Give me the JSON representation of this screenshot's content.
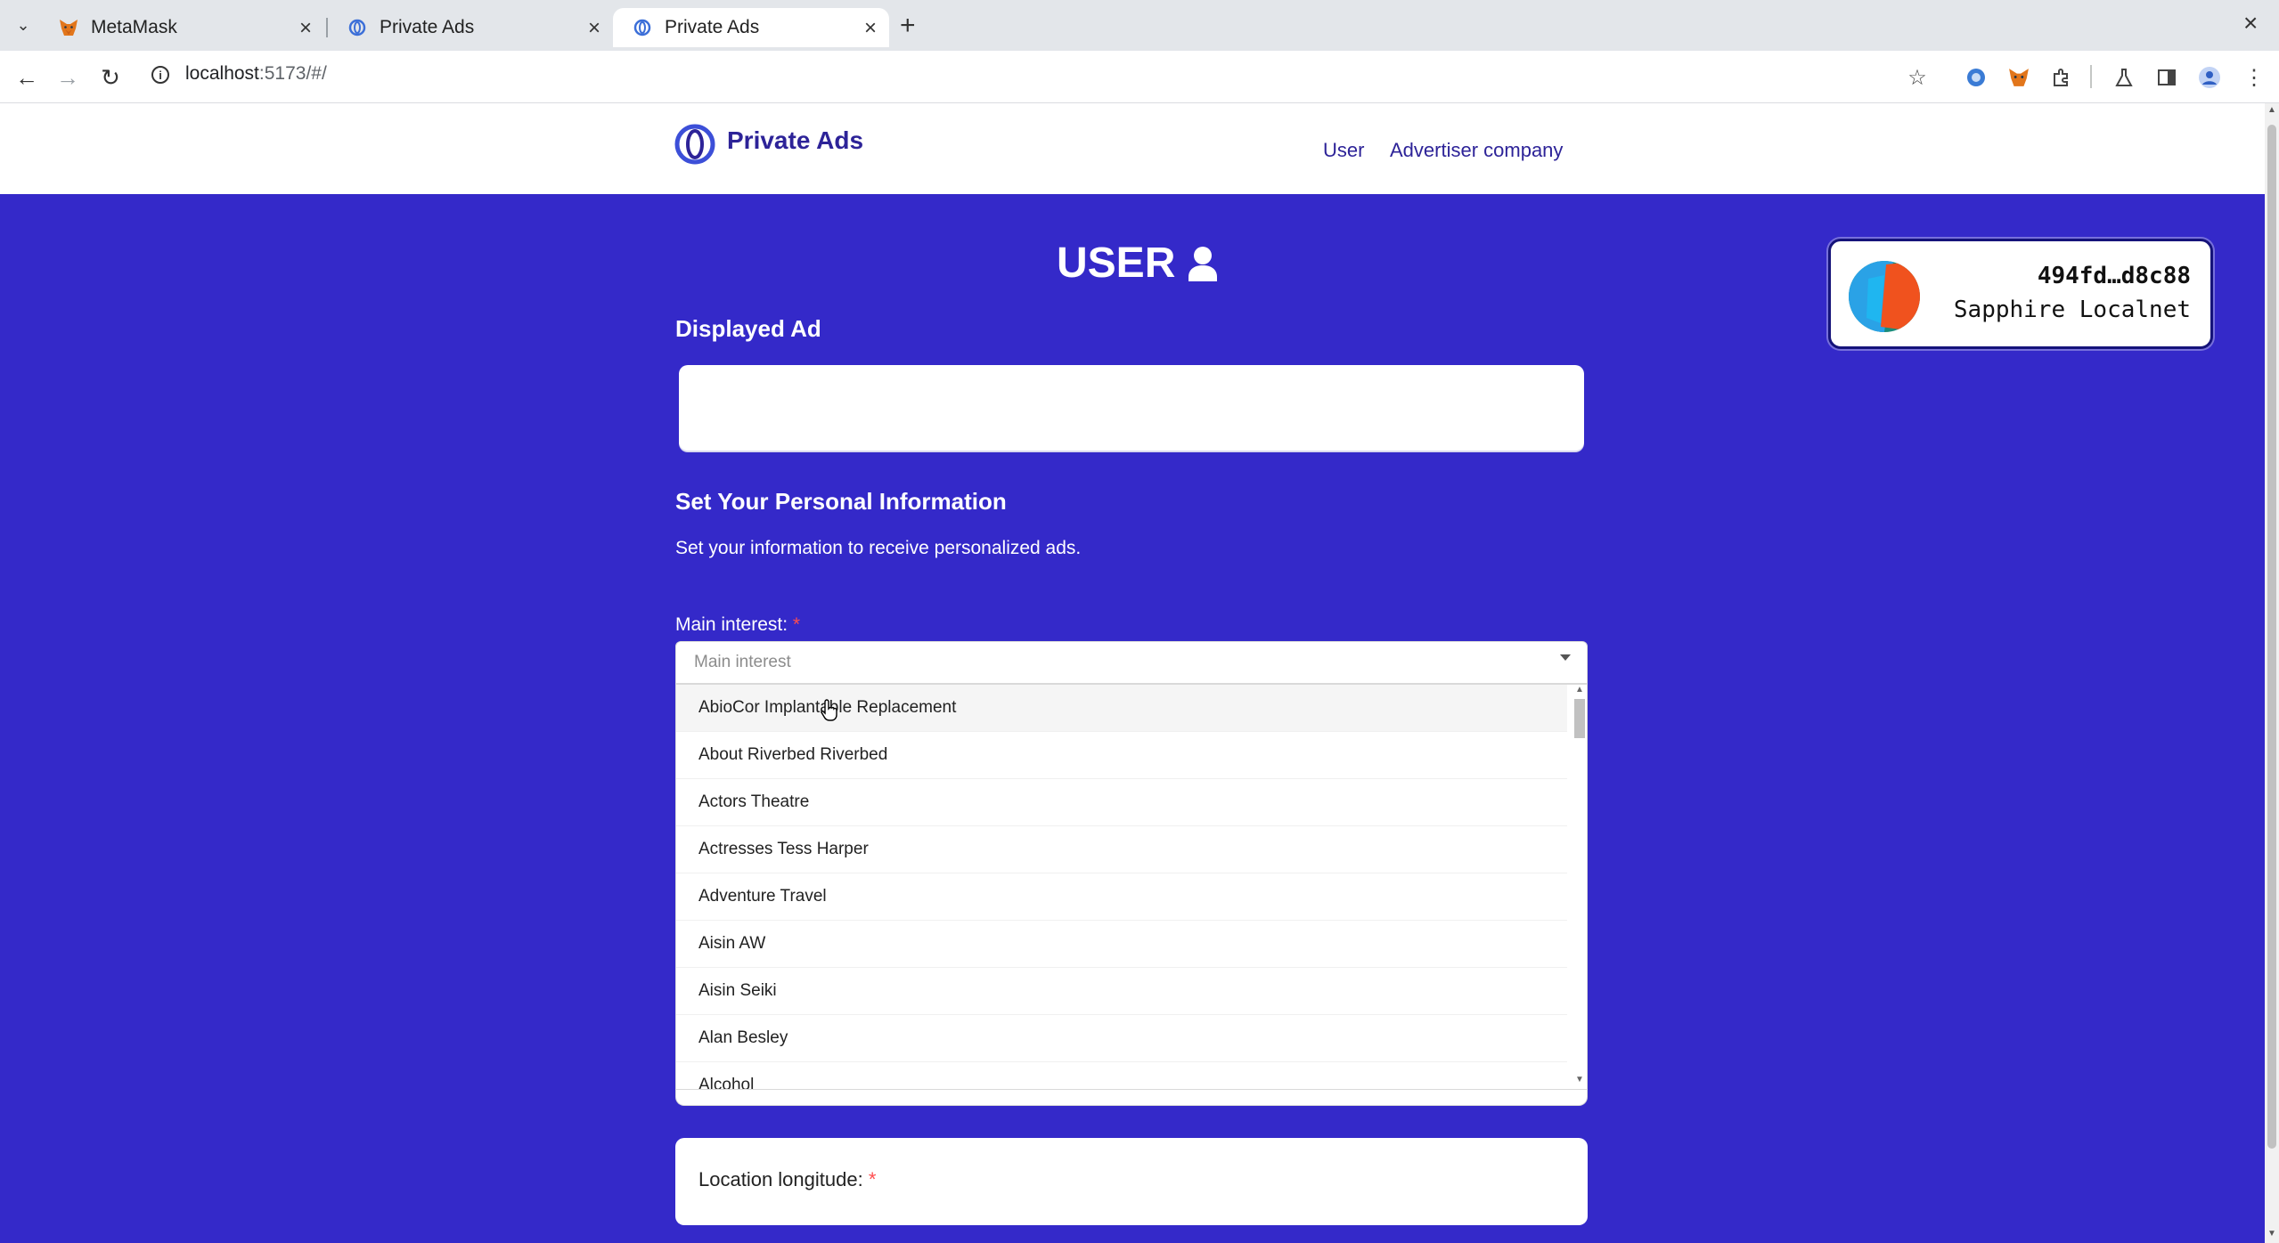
{
  "browser": {
    "tabs": [
      {
        "title": "MetaMask",
        "icon": "metamask-fox-icon",
        "active": false
      },
      {
        "title": "Private Ads",
        "icon": "oasis-logo-icon",
        "active": false
      },
      {
        "title": "Private Ads",
        "icon": "oasis-logo-icon",
        "active": true
      }
    ],
    "url_host": "localhost",
    "url_path": ":5173/#/"
  },
  "site": {
    "brand": "Private Ads",
    "nav": [
      "User",
      "Advertiser company"
    ]
  },
  "wallet": {
    "address": "494fd…d8c88",
    "network": "Sapphire Localnet"
  },
  "page": {
    "title": "USER",
    "displayed_ad_heading": "Displayed Ad",
    "personal_info_heading": "Set Your Personal Information",
    "personal_info_desc": "Set your information to receive personalized ads.",
    "main_interest_label": "Main interest:",
    "required_mark": "*",
    "main_interest_placeholder": "Main interest",
    "interest_options": [
      "AbioCor Implantable Replacement",
      "About Riverbed Riverbed",
      "Actors Theatre",
      "Actresses Tess Harper",
      "Adventure Travel",
      "Aisin AW",
      "Aisin Seiki",
      "Alan Besley",
      "Alcohol"
    ],
    "location_longitude_label": "Location longitude:"
  },
  "colors": {
    "page_bg": "#3429c9",
    "brand": "#2d2398",
    "required": "#ff4d4f"
  }
}
